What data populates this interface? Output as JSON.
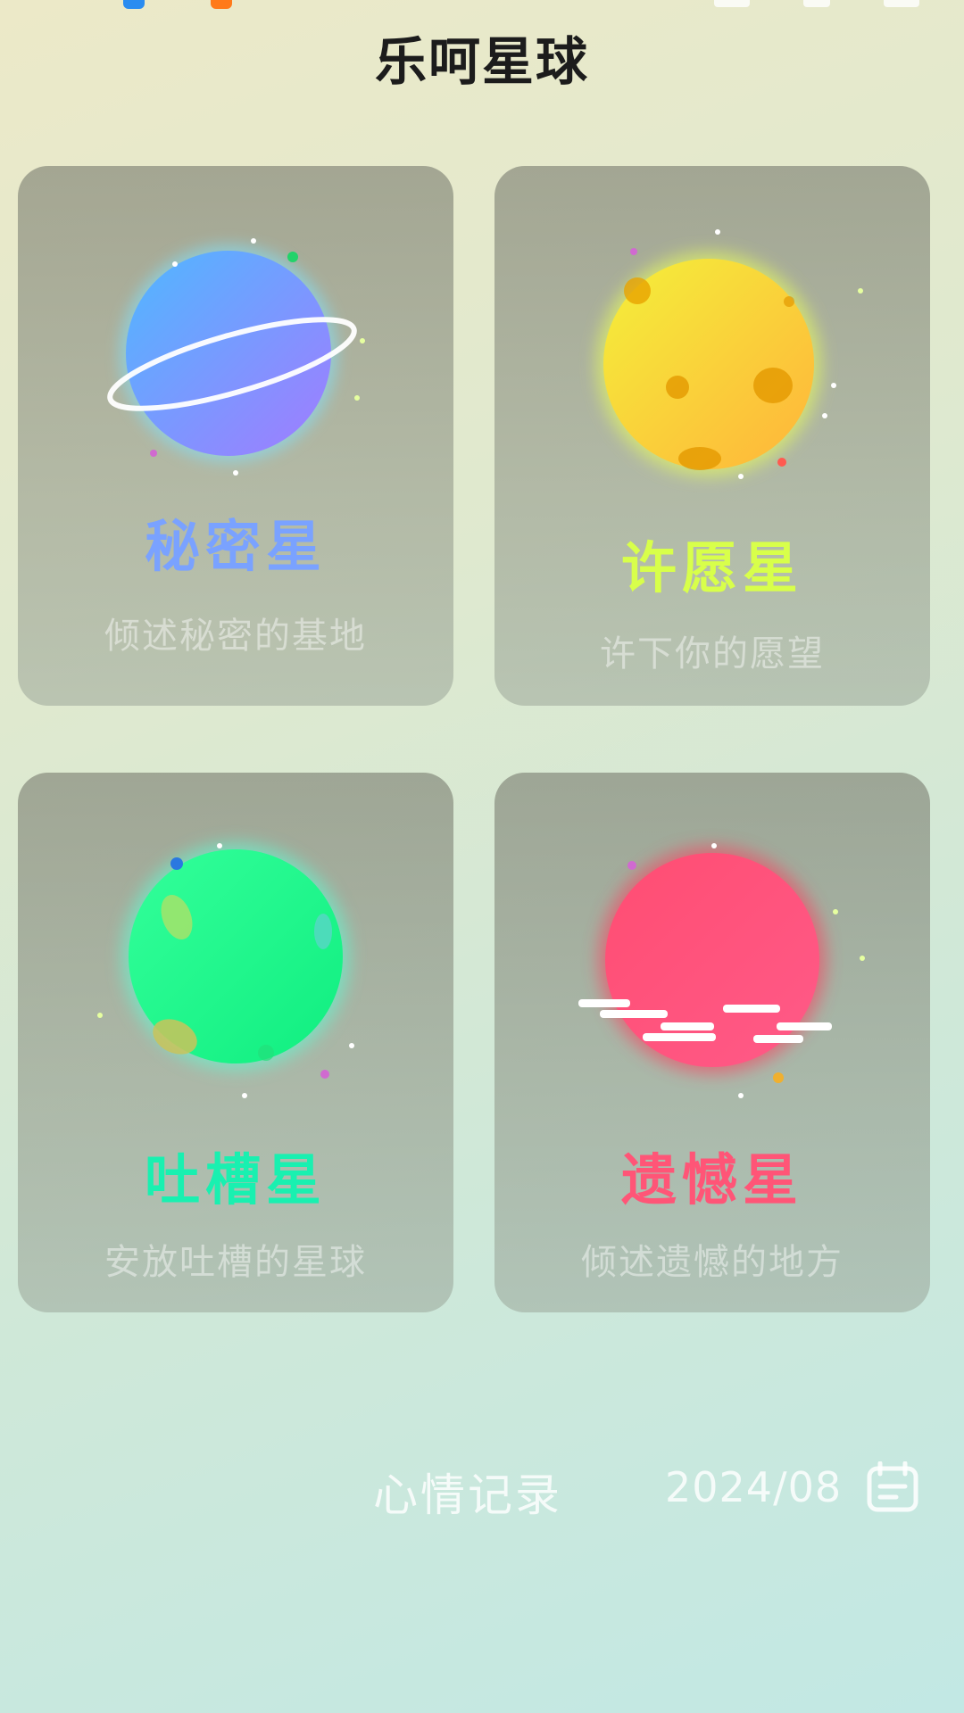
{
  "header": {
    "title": "乐呵星球"
  },
  "cards": [
    {
      "title": "秘密星",
      "subtitle": "倾述秘密的基地",
      "title_color": "#7aa2ff",
      "planet": "ringed-blue-purple-planet-icon"
    },
    {
      "title": "许愿星",
      "subtitle": "许下你的愿望",
      "title_color": "#d8ff4a",
      "planet": "yellow-cratered-planet-icon"
    },
    {
      "title": "吐槽星",
      "subtitle": "安放吐槽的星球",
      "title_color": "#19f0b0",
      "planet": "green-planet-icon"
    },
    {
      "title": "遗憾星",
      "subtitle": "倾述遗憾的地方",
      "title_color": "#ff5577",
      "planet": "red-clouded-planet-icon"
    }
  ],
  "footer": {
    "mood_label": "心情记录",
    "date": "2024/08",
    "calendar_icon": "calendar-icon"
  }
}
